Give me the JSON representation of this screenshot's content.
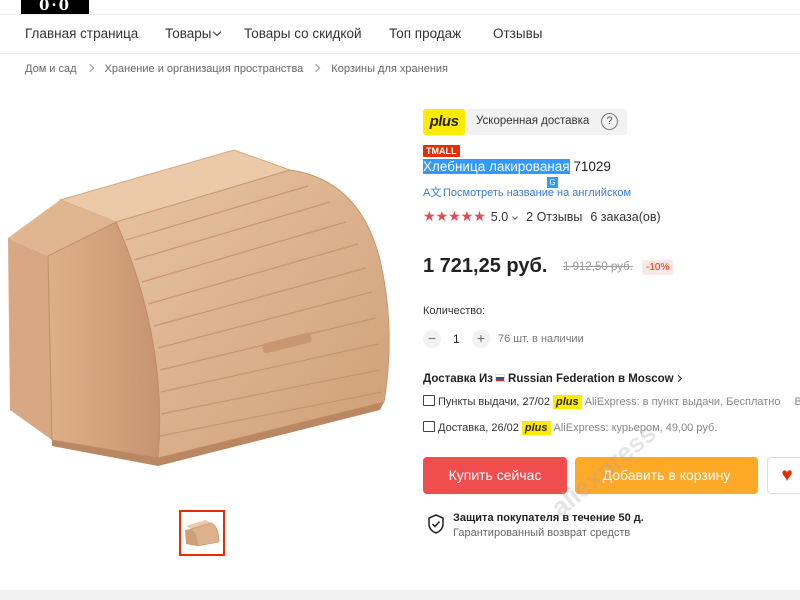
{
  "logo": {
    "text": "0·0"
  },
  "nav": {
    "items": [
      "Главная страница",
      "Товары",
      "Товары со скидкой",
      "Топ продаж",
      "Отзывы"
    ]
  },
  "breadcrumb": [
    "Дом и сад",
    "Хранение и организация пространства",
    "Корзины для хранения"
  ],
  "plus": {
    "badge": "plus",
    "label": "Ускоренная доставка",
    "help": "?"
  },
  "tmall": "TMALL",
  "product": {
    "title_selected": "Хлебница лакированая",
    "title_rest": " 71029",
    "translate_text": "Посмотреть название на английском",
    "translate_icon": "A文",
    "stars": "★★★★★",
    "rating": "5.0",
    "reviews": "2 Отзывы",
    "orders": "6 заказа(ов)"
  },
  "price": {
    "current": "1 721,25 руб.",
    "old": "1 912,50 руб.",
    "discount": "-10%"
  },
  "quantity": {
    "label": "Количество:",
    "minus": "−",
    "value": "1",
    "plus": "+",
    "stock": "76 шт. в наличии"
  },
  "delivery": {
    "head_prefix": "Доставка Из",
    "head_country": "Russian Federation в Moscow",
    "row1_prefix": "Пункты выдачи, 27/02",
    "row1_plus": "plus",
    "row1_rest": "AliExpress: в пункт выдачи, Бесплатно",
    "row1_cut": "Вы",
    "row2_prefix": "Доставка, 26/02",
    "row2_plus": "plus",
    "row2_rest": "AliExpress: курьером, 49,00 руб."
  },
  "buttons": {
    "buy": "Купить сейчас",
    "cart": "Добавить в корзину",
    "wish": "♥"
  },
  "protection": {
    "title": "Защита покупателя в течение 50 д.",
    "subtitle": "Гарантированный возврат средств"
  },
  "watermark": "aliexpress",
  "colors": {
    "accent_red": "#e62e04",
    "buy_button": "#f04e4e",
    "cart_button": "#ffa929",
    "plus_yellow": "#ffeb00",
    "star_red": "#e84855",
    "link_blue": "#3a7bd5"
  }
}
